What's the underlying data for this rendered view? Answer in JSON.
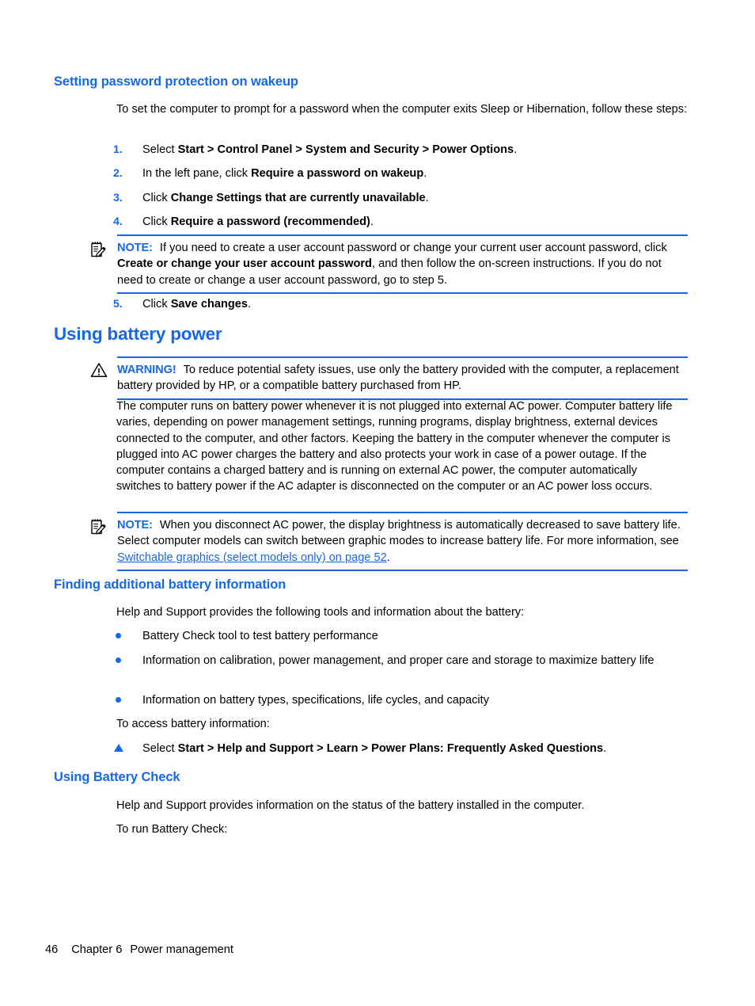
{
  "section1": {
    "heading": "Setting password protection on wakeup",
    "intro": "To set the computer to prompt for a password when the computer exits Sleep or Hibernation, follow these steps:",
    "steps": [
      {
        "num": "1.",
        "pre": "Select ",
        "strong": "Start > Control Panel > System and Security > Power Options",
        "post": "."
      },
      {
        "num": "2.",
        "pre": "In the left pane, click ",
        "strong": "Require a password on wakeup",
        "post": "."
      },
      {
        "num": "3.",
        "pre": "Click ",
        "strong": "Change Settings that are currently unavailable",
        "post": "."
      },
      {
        "num": "4.",
        "pre": "Click ",
        "strong": "Require a password (recommended)",
        "post": "."
      },
      {
        "num": "5.",
        "pre": "Click ",
        "strong": "Save changes",
        "post": "."
      }
    ],
    "note": {
      "label": "NOTE:",
      "icon": "note-pencil-icon",
      "text_pre": "If you need to create a user account password or change your current user account password, click ",
      "strong": "Create or change your user account password",
      "text_post": ", and then follow the on-screen instructions. If you do not need to create or change a user account password, go to step 5."
    }
  },
  "section2": {
    "heading": "Using battery power",
    "warning": {
      "label": "WARNING!",
      "icon": "warning-triangle-icon",
      "text": "To reduce potential safety issues, use only the battery provided with the computer, a replacement battery provided by HP, or a compatible battery purchased from HP."
    },
    "paragraph": "The computer runs on battery power whenever it is not plugged into external AC power. Computer battery life varies, depending on power management settings, running programs, display brightness, external devices connected to the computer, and other factors. Keeping the battery in the computer whenever the computer is plugged into AC power charges the battery and also protects your work in case of a power outage. If the computer contains a charged battery and is running on external AC power, the computer automatically switches to battery power if the AC adapter is disconnected on the computer or an AC power loss occurs.",
    "note": {
      "label": "NOTE:",
      "icon": "note-pencil-icon",
      "text_pre": "When you disconnect AC power, the display brightness is automatically decreased to save battery life. Select computer models can switch between graphic modes to increase battery life. For more information, see ",
      "link": "Switchable graphics (select models only) on page 52",
      "text_post": "."
    }
  },
  "section3": {
    "heading": "Finding additional battery information",
    "intro": "Help and Support provides the following tools and information about the battery:",
    "bullets": [
      "Battery Check tool to test battery performance",
      "Information on calibration, power management, and proper care and storage to maximize battery life",
      "Information on battery types, specifications, life cycles, and capacity"
    ],
    "access_line": "To access battery information:",
    "step": {
      "pre": "Select ",
      "strong": "Start > Help and Support > Learn > Power Plans: Frequently Asked Questions",
      "post": "."
    }
  },
  "section4": {
    "heading": "Using Battery Check",
    "paragraph": "Help and Support provides information on the status of the battery installed in the computer.",
    "run_line": "To run Battery Check:"
  },
  "footer": {
    "page_number": "46",
    "chapter": "Chapter 6",
    "title": "Power management"
  }
}
